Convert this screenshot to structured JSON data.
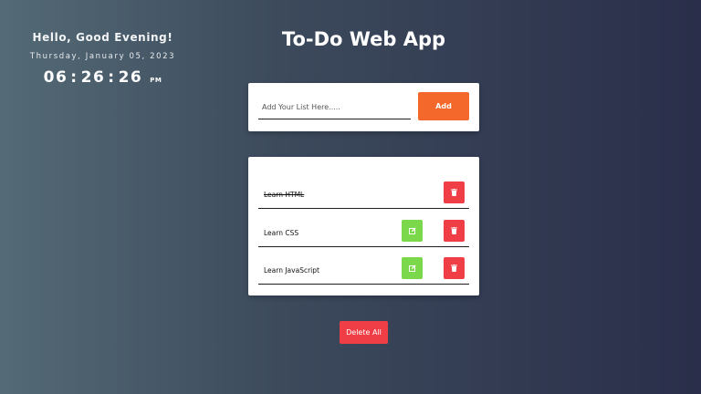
{
  "clock": {
    "greeting": "Hello, Good Evening!",
    "date": "Thursday, January 05, 2023",
    "hours": "06",
    "minutes": "26",
    "seconds": "26",
    "separator": ":",
    "meridiem": "PM"
  },
  "app": {
    "title": "To-Do Web App"
  },
  "input": {
    "placeholder": "Add Your List Here.....",
    "value": "",
    "add_label": "Add"
  },
  "todos": [
    {
      "text": "Learn HTML",
      "completed": true,
      "editable": false
    },
    {
      "text": "Learn CSS",
      "completed": false,
      "editable": true
    },
    {
      "text": "Learn JavaScript",
      "completed": false,
      "editable": true
    }
  ],
  "actions": {
    "delete_all_label": "Delete All"
  },
  "colors": {
    "accent_add": "#f4682c",
    "edit": "#7ad84a",
    "delete": "#ef3e45"
  },
  "icons": {
    "edit": "edit-icon",
    "delete": "trash-icon"
  }
}
